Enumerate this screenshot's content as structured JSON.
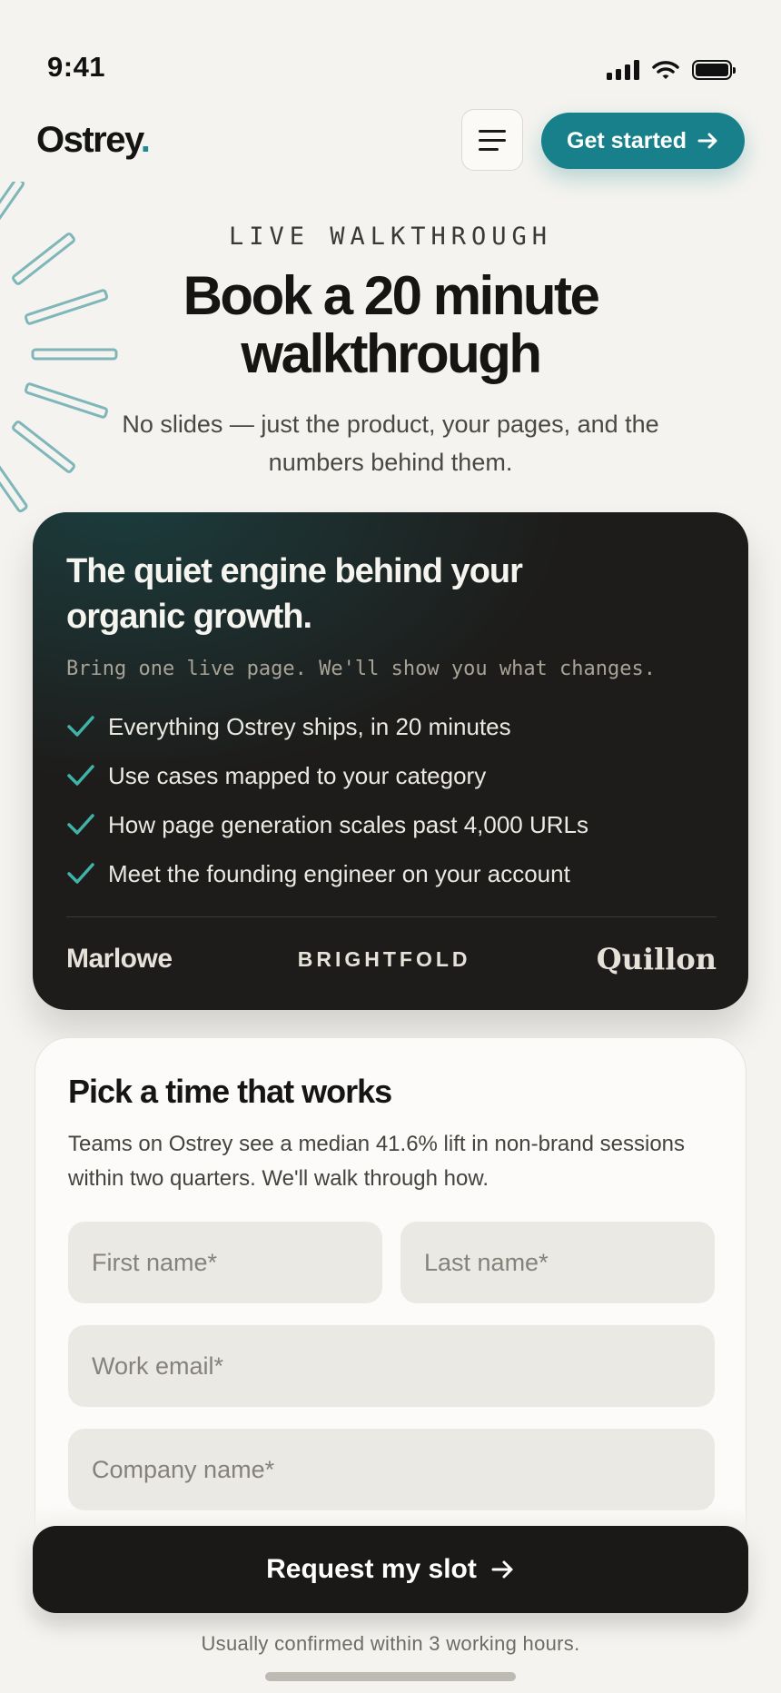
{
  "status_bar": {
    "time": "9:41",
    "icons": [
      "cellular-signal-icon",
      "wifi-icon",
      "battery-icon"
    ]
  },
  "header": {
    "logo_text": "Ostrey",
    "logo_dot": ".",
    "cta_label": "Get started",
    "icons": [
      "hamburger-menu-icon",
      "arrow-right-icon"
    ]
  },
  "hero": {
    "eyebrow": "LIVE WALKTHROUGH",
    "title_line1": "Book a 20 minute",
    "title_line2": "walkthrough",
    "subtitle": "No slides — just the product, your pages, and the numbers behind them."
  },
  "feature_card": {
    "title": "The quiet engine behind your organic growth.",
    "tagline": "Bring one live page. We'll show you what changes.",
    "checklist": [
      "Everything Ostrey ships, in 20 minutes",
      "Use cases mapped to your category",
      "How page generation scales past 4,000 URLs",
      "Meet the founding engineer on your account"
    ],
    "brands": [
      "Marlowe",
      "BRIGHTFOLD",
      "Quillon"
    ]
  },
  "form": {
    "title": "Pick a time that works",
    "description": "Teams on Ostrey see a median 41.6% lift in non-brand sessions within two quarters. We'll walk through how.",
    "first_name_placeholder": "First name*",
    "last_name_placeholder": "Last name*",
    "email_placeholder": "Work email*",
    "company_placeholder": "Company name*",
    "submit_label": "Request my slot",
    "note": "Usually confirmed within 3 working hours."
  },
  "colors": {
    "accent": "#17808a",
    "background": "#f4f3ef",
    "dark_card": "#1d1c1a",
    "check": "#3fb3a8"
  }
}
